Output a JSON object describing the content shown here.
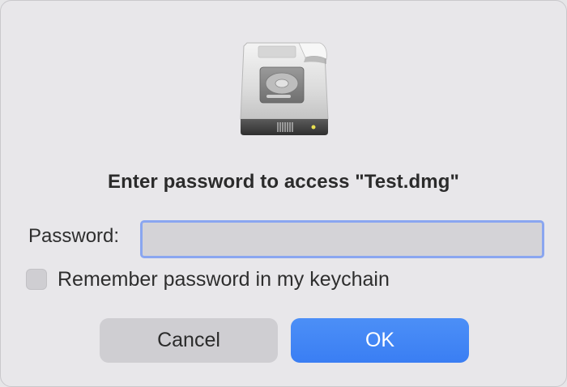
{
  "dialog": {
    "icon": "disk-image-icon",
    "title": "Enter password to access \"Test.dmg\"",
    "password_label": "Password:",
    "password_value": "",
    "remember_label": "Remember password in my keychain",
    "remember_checked": false,
    "cancel_label": "Cancel",
    "ok_label": "OK"
  },
  "colors": {
    "dialog_background": "#e8e7ea",
    "focus_ring": "#8aa6f0",
    "ok_button": "#3f84f5",
    "cancel_button": "#cfced2"
  }
}
